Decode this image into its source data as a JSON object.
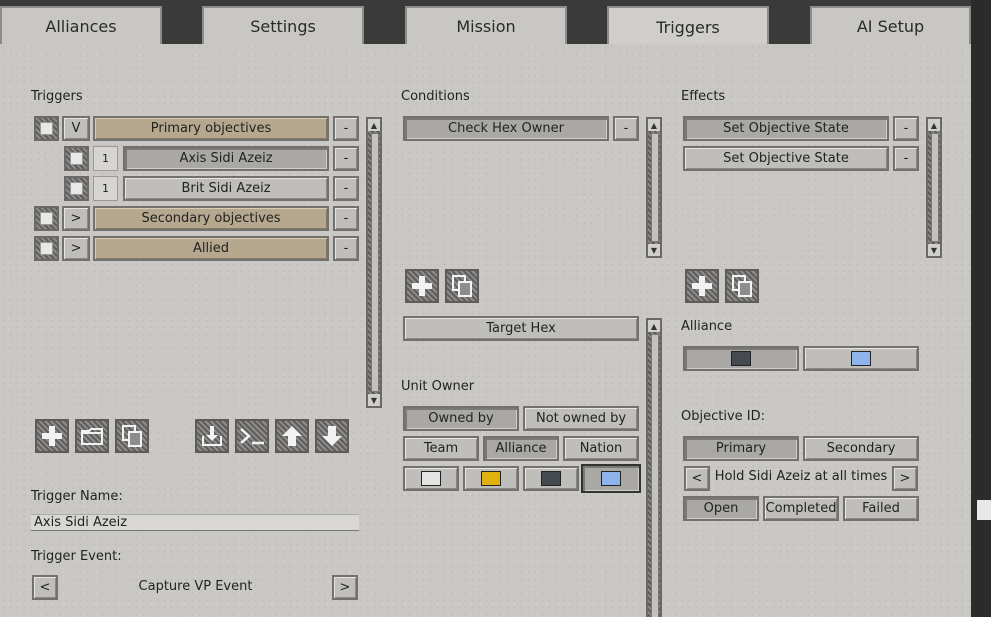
{
  "tabs": [
    "Alliances",
    "Settings",
    "Mission",
    "Triggers",
    "AI Setup"
  ],
  "triggers": {
    "heading": "Triggers",
    "rows": [
      {
        "toggle": "V",
        "label": "Primary objectives",
        "remove": "-"
      },
      {
        "index": "1",
        "label": "Axis Sidi Azeiz",
        "remove": "-"
      },
      {
        "index": "1",
        "label": "Brit Sidi Azeiz",
        "remove": "-"
      },
      {
        "toggle": ">",
        "label": "Secondary objectives",
        "remove": "-"
      },
      {
        "toggle": ">",
        "label": "Allied",
        "remove": "-"
      }
    ],
    "toolbar_icons": [
      "add-icon",
      "folder-icon",
      "copy-icon",
      "import-icon",
      "console-icon",
      "arrow-up-icon",
      "arrow-down-icon"
    ],
    "name_label": "Trigger Name:",
    "name_value": "Axis Sidi Azeiz",
    "event_label": "Trigger Event:",
    "event_prev": "<",
    "event_value": "Capture VP Event",
    "event_next": ">"
  },
  "conditions": {
    "heading": "Conditions",
    "items": [
      {
        "label": "Check Hex Owner",
        "remove": "-"
      }
    ],
    "target_button": "Target Hex",
    "unit_owner_label": "Unit Owner",
    "owned_by": "Owned by",
    "not_owned_by": "Not owned by",
    "team": "Team",
    "alliance": "Alliance",
    "nation": "Nation",
    "swatches": [
      "#e3e3e3",
      "#e0b10f",
      "#454a50",
      "#8fb4ec"
    ]
  },
  "effects": {
    "heading": "Effects",
    "items": [
      {
        "label": "Set Objective State",
        "remove": "-"
      },
      {
        "label": "Set Objective State",
        "remove": "-"
      }
    ],
    "alliance_label": "Alliance",
    "alliance_swatches": [
      "#454a50",
      "#8fb4ec"
    ],
    "objective_id_label": "Objective ID:",
    "primary": "Primary",
    "secondary": "Secondary",
    "objective_prev": "<",
    "objective_value": "Hold Sidi Azeiz at all times",
    "objective_next": ">",
    "open": "Open",
    "completed": "Completed",
    "failed": "Failed"
  }
}
